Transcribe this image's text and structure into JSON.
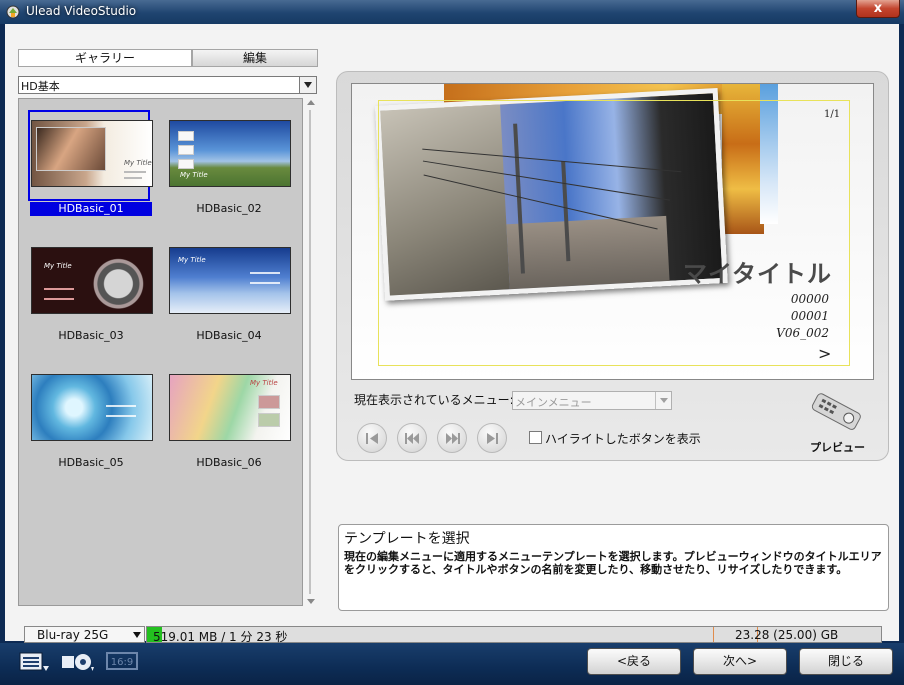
{
  "window": {
    "title": "Ulead VideoStudio",
    "close_symbol": "x"
  },
  "tabs": [
    {
      "label": "ギャラリー",
      "active": true
    },
    {
      "label": "編集",
      "active": false
    }
  ],
  "gallery": {
    "category": "HD基本",
    "selected_index": 0,
    "items": [
      {
        "label": "HDBasic_01",
        "thumb_title": "My Title"
      },
      {
        "label": "HDBasic_02",
        "thumb_title": "My Title"
      },
      {
        "label": "HDBasic_03",
        "thumb_title": "My Title"
      },
      {
        "label": "HDBasic_04",
        "thumb_title": "My Title"
      },
      {
        "label": "HDBasic_05",
        "thumb_title": ""
      },
      {
        "label": "HDBasic_06",
        "thumb_title": "My Title"
      }
    ]
  },
  "preview": {
    "page_indicator": "1/1",
    "title": "マイタイトル",
    "items": [
      "00000",
      "00001",
      "V06_002"
    ],
    "next_symbol": ">"
  },
  "menu": {
    "label": "現在表示されているメニュー:",
    "current": "メインメニュー"
  },
  "controls": {
    "buttons": [
      "first-chapter",
      "previous-chapter",
      "next-chapter",
      "last-chapter"
    ],
    "highlight_checkbox": {
      "label": "ハイライトしたボタンを表示",
      "checked": false
    },
    "preview_label": "プレビュー"
  },
  "description": {
    "title": "テンプレートを選択",
    "body": "現在の編集メニューに適用するメニューテンプレートを選択します。プレビューウィンドウのタイトルエリアをクリックすると、タイトルやボタンの名前を変更したり、移動させたり、リサイズしたりできます。"
  },
  "status": {
    "disc_type": "Blu-ray 25G",
    "used_text": "519.01 MB / 1 分 23 秒",
    "capacity_text": "23.28 (25.00) GB",
    "used_fraction": 0.02
  },
  "footer": {
    "back": "<戻る",
    "next": "次へ>",
    "close": "閉じる",
    "aspect_icon_text": "16:9"
  },
  "colors": {
    "titlebar": "#1f4470",
    "selection": "#0000e0",
    "capacity_fill": "#23c01f",
    "footer": "#0d2c55"
  }
}
